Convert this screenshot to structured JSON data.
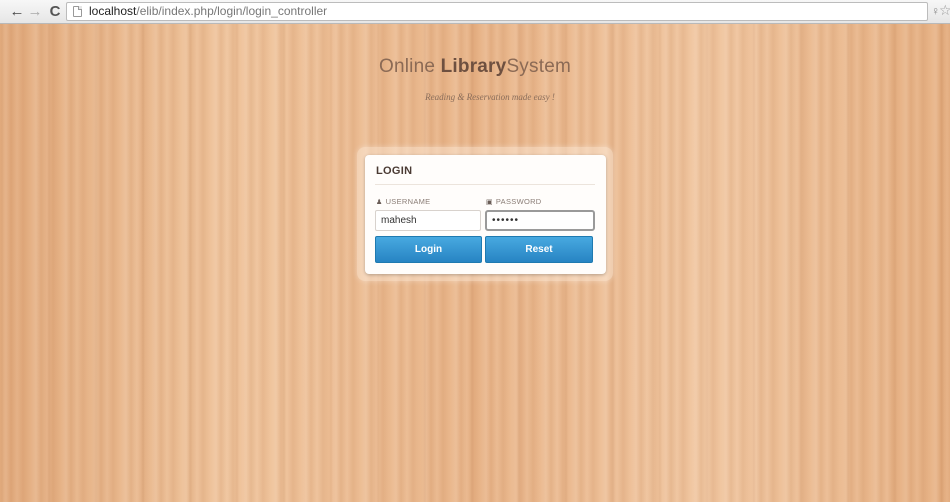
{
  "browser": {
    "url_host": "localhost",
    "url_path": "/elib/index.php/login/login_controller",
    "icons": {
      "back": "arrow-left-icon",
      "forward": "arrow-right-icon",
      "reload": "reload-icon",
      "page": "page-icon",
      "extension": "extension-icon",
      "bookmark": "star-icon"
    }
  },
  "site": {
    "title_part1": "Online ",
    "title_part2": "Library",
    "title_part3": "System",
    "tagline": "Reading & Reservation made easy !"
  },
  "login": {
    "heading": "LOGIN",
    "username_label": "USERNAME",
    "password_label": "PASSWORD",
    "username_value": "mahesh",
    "password_value": "******",
    "login_button": "Login",
    "reset_button": "Reset"
  },
  "colors": {
    "wood_base": "#e9b68b",
    "button_primary": "#2f8fcf",
    "card_background": "#fffdfb"
  }
}
